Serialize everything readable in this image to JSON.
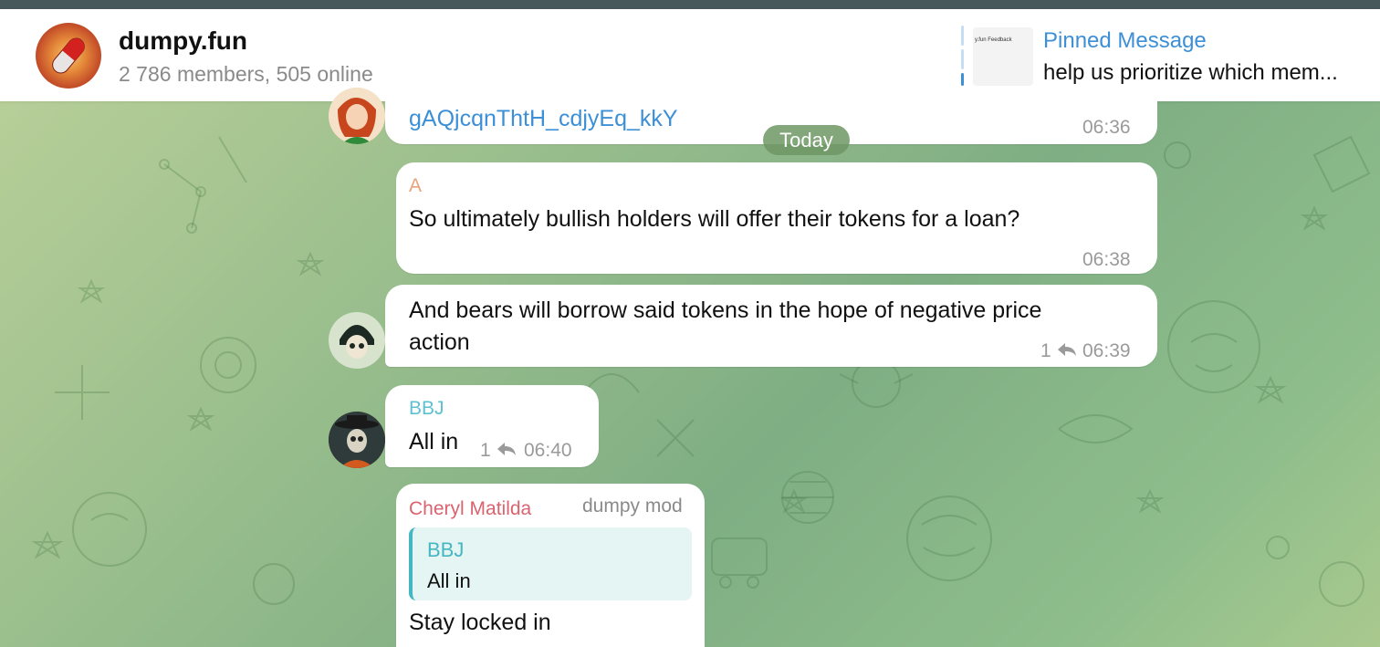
{
  "chat": {
    "title": "dumpy.fun",
    "subtitle": "2 786 members, 505 online"
  },
  "pinned": {
    "label": "Pinned Message",
    "text": "help us prioritize which mem...",
    "thumb_text": "y.fun Feedback"
  },
  "date_separator": "Today",
  "messages": [
    {
      "text": "gAQjcqnThtH_cdjyEq_kkY",
      "time": "06:36"
    },
    {
      "sender": "A",
      "text": "So ultimately bullish holders will offer their tokens for a loan?",
      "time": "06:38"
    },
    {
      "text_line1": "And bears will borrow said tokens in the hope of negative price",
      "text_line2": "action",
      "replies": "1",
      "time": "06:39"
    },
    {
      "sender": "BBJ",
      "text": "All in",
      "replies": "1",
      "time": "06:40"
    },
    {
      "sender": "Cheryl Matilda",
      "badge": "dumpy mod",
      "quote_sender": "BBJ",
      "quote_text": "All in",
      "text": "Stay locked in"
    }
  ],
  "colors": {
    "accent": "#3d8fd6",
    "sender_a": "#e8a27c",
    "sender_bbj": "#5ec0d0",
    "sender_cheryl": "#d9636f",
    "quote_bar": "#45b7c2"
  }
}
